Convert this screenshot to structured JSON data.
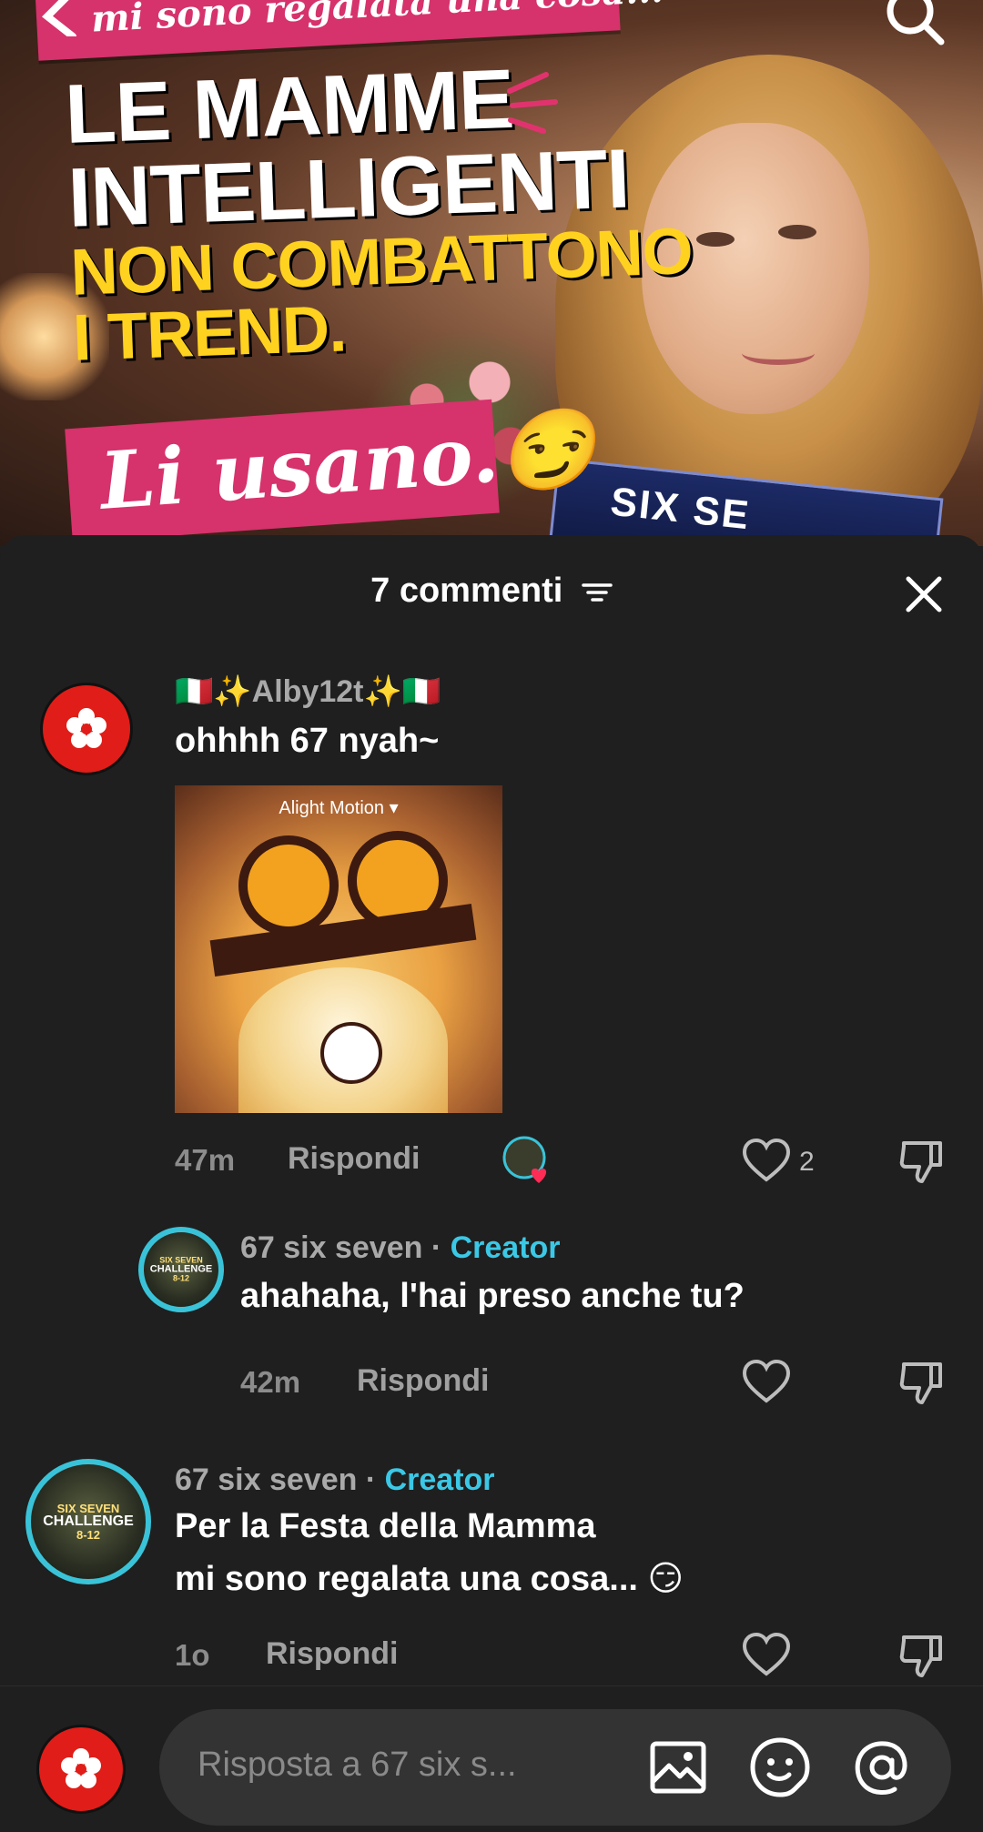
{
  "video": {
    "banner_top": "mi sono regalata una cosa...",
    "headline_lines": [
      "LE MAMME",
      "INTELLIGENTI",
      "NON COMBATTONO",
      "I TREND."
    ],
    "banner_bottom": "Li usano.😏",
    "magazine_text": "SIX SE"
  },
  "sheet": {
    "title": "7 commenti"
  },
  "comments": [
    {
      "username": "🇮🇹✨Alby12t✨🇮🇹",
      "text": "ohhhh 67 nyah~",
      "gif_watermark": "Alight Motion ▾",
      "time": "47m",
      "reply_label": "Rispondi",
      "likes": "2"
    },
    {
      "username": "67 six seven · ",
      "creator_label": "Creator",
      "text": "ahahaha, l'hai preso anche tu?",
      "time": "42m",
      "reply_label": "Rispondi"
    },
    {
      "username": "67 six seven · ",
      "creator_label": "Creator",
      "text_line1": "Per la Festa della Mamma",
      "text_line2": "mi sono regalata una cosa... 😏",
      "time": "1o",
      "reply_label": "Rispondi"
    }
  ],
  "badge": {
    "line1": "SIX SEVEN",
    "line2": "CHALLENGE",
    "line3": "8-12"
  },
  "input": {
    "placeholder": "Risposta a 67 six s..."
  },
  "colors": {
    "sheet_bg": "#1f1f1f",
    "creator_accent": "#3bc8e6",
    "banner_pink": "#d6326b",
    "headline_yellow": "#ffd21f"
  }
}
